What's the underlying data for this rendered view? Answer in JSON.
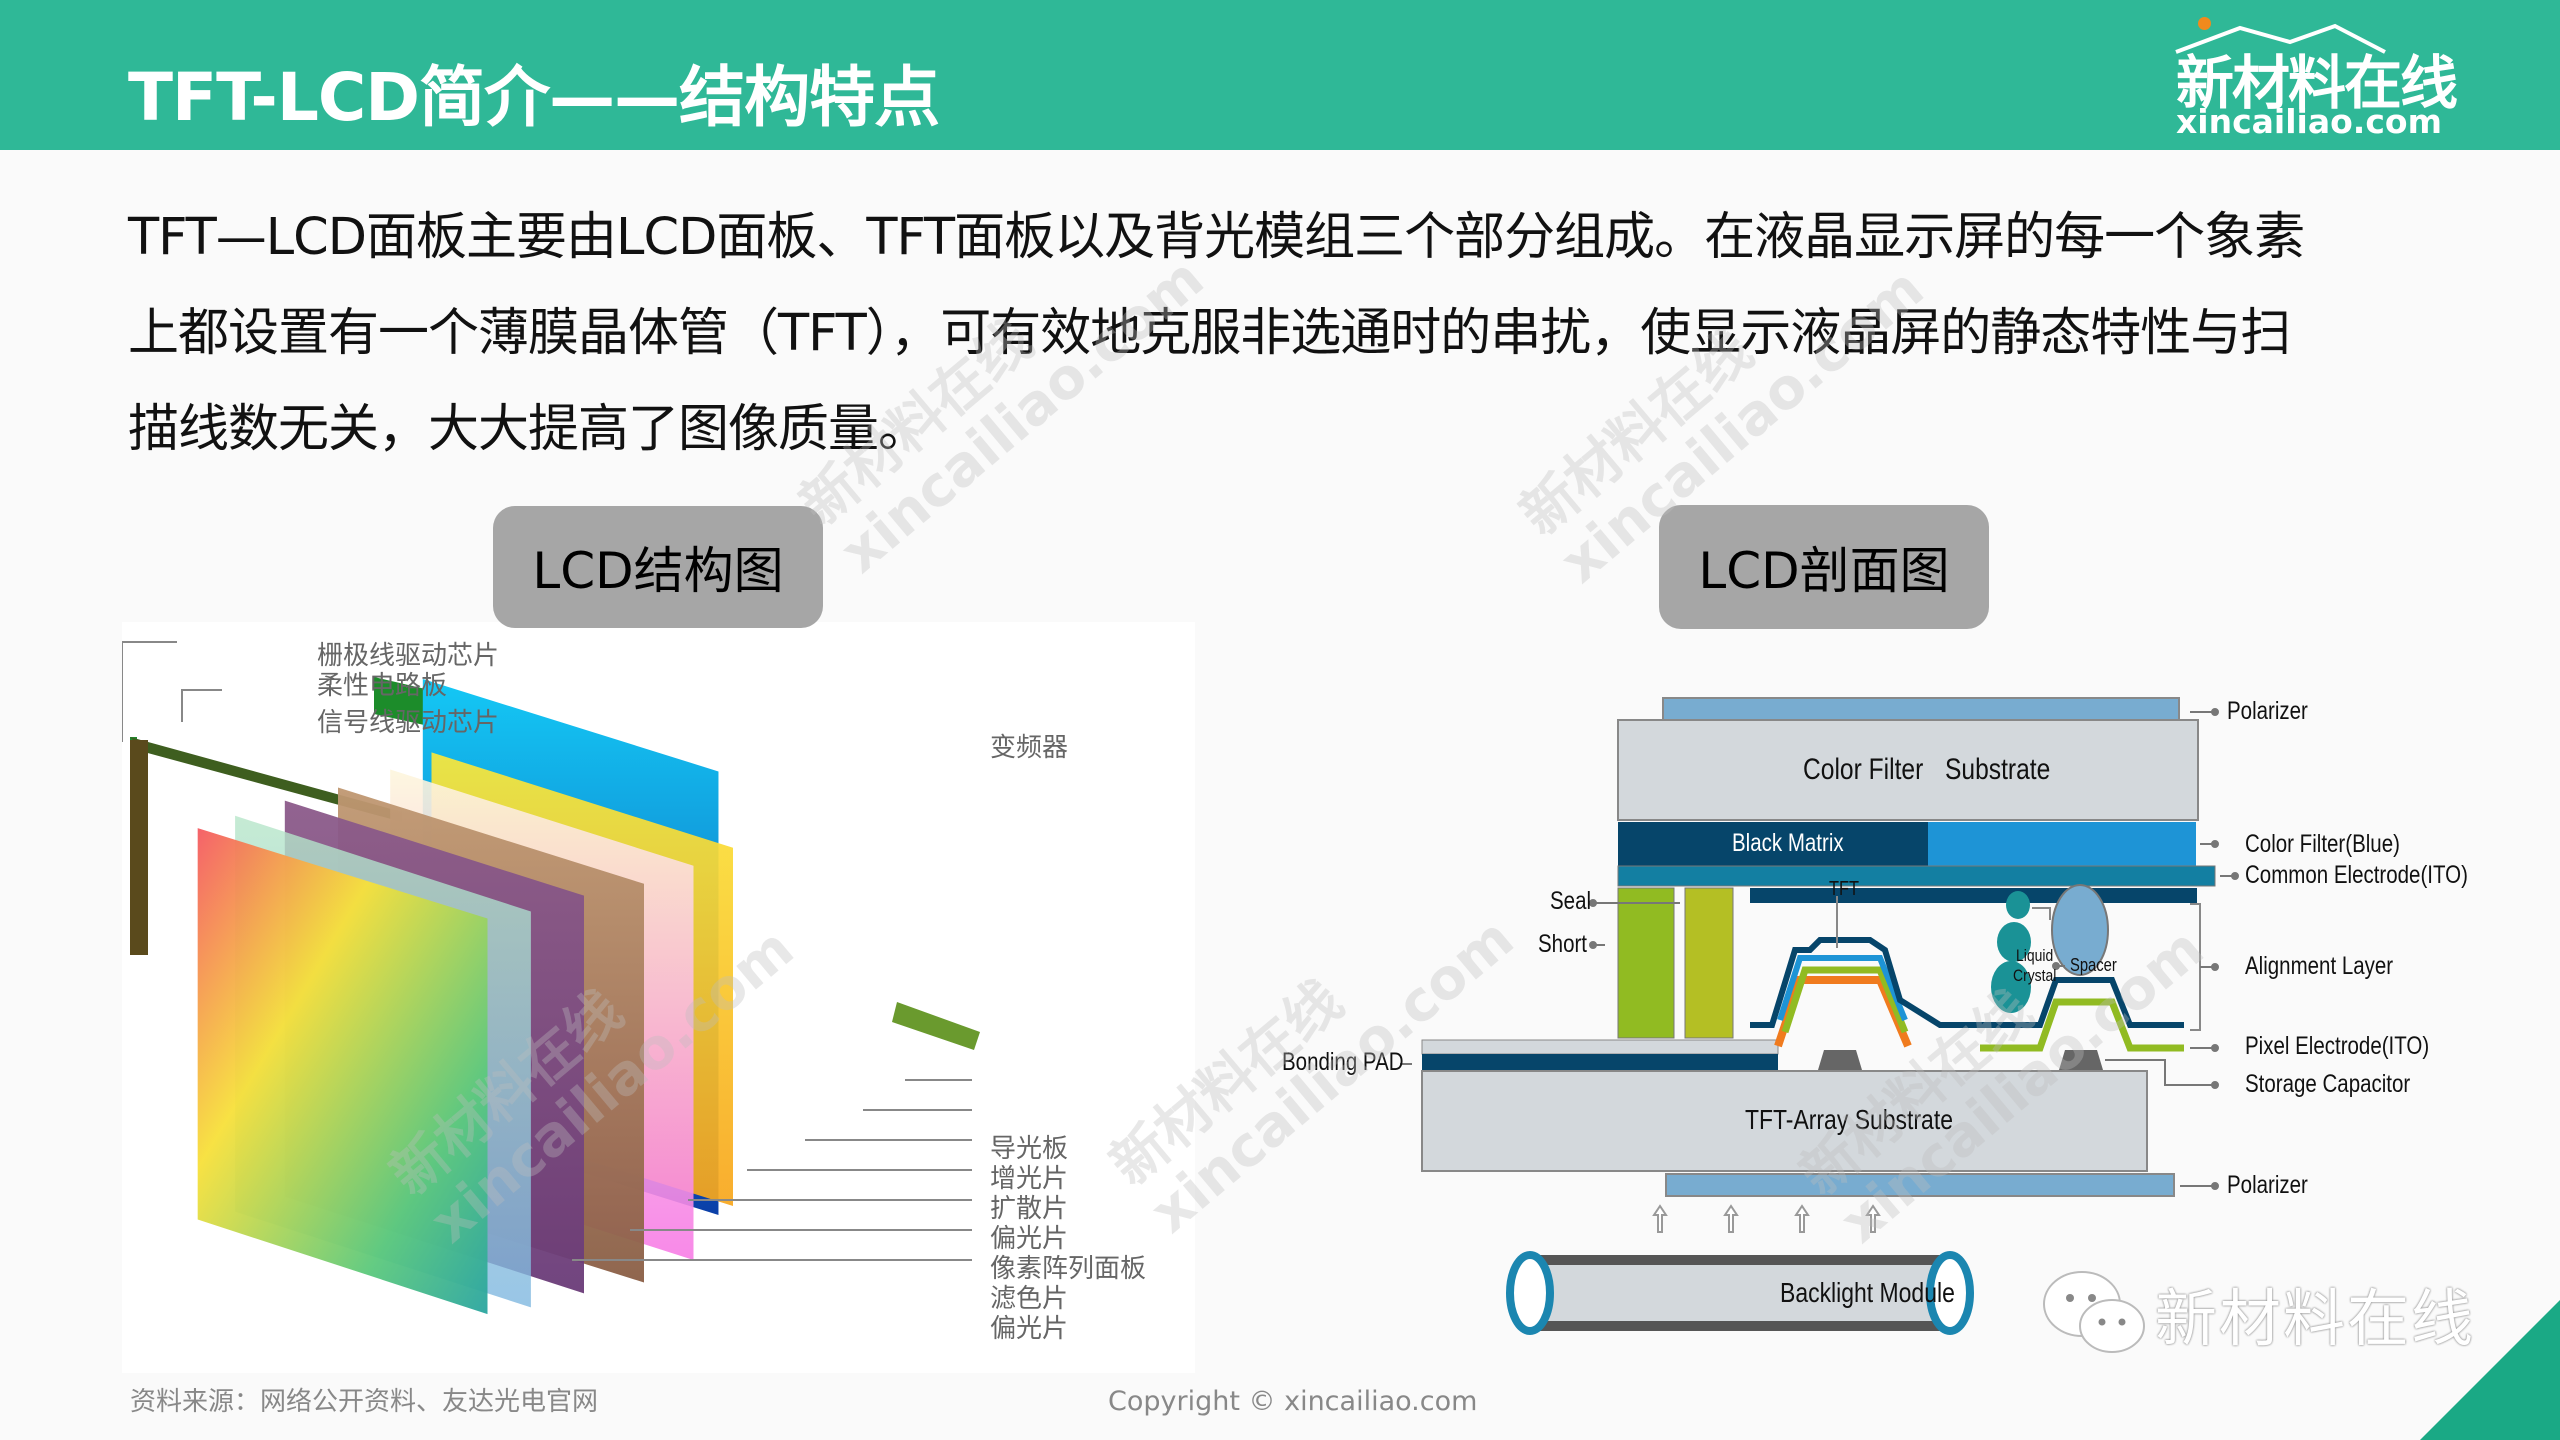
{
  "header": {
    "title": "TFT-LCD简介——结构特点",
    "logo": {
      "cn": "新材料在线",
      "en": "xincailiao.com"
    }
  },
  "body_text": [
    "TFT—LCD面板主要由LCD面板、TFT面板以及背光模组三个部分组成。在液晶显示屏的每一个象素",
    "上都设置有一个薄膜晶体管（TFT），可有效地克服非选通时的串扰，使显示液晶屏的静态特性与扫",
    "描线数无关，大大提高了图像质量。"
  ],
  "sections": {
    "left_label": "LCD结构图",
    "right_label": "LCD剖面图"
  },
  "structure_diagram": {
    "top_labels": [
      "栅极线驱动芯片",
      "柔性电路板",
      "信号线驱动芯片"
    ],
    "inverter_label": "变频器",
    "layer_labels": [
      "导光板",
      "增光片",
      "扩散片",
      "偏光片",
      "像素阵列面板",
      "滤色片",
      "偏光片"
    ]
  },
  "cross_section": {
    "polarizer_top": "Polarizer",
    "color_filter_substrate": [
      "Color Filter",
      "Substrate"
    ],
    "black_matrix": "Black Matrix",
    "color_filter_blue": "Color Filter(Blue)",
    "common_electrode": "Common Electrode(ITO)",
    "seal": "Seal",
    "short": "Short",
    "tft": "TFT",
    "liquid_crystal": [
      "Liquid",
      "Crystal"
    ],
    "spacer": "Spacer",
    "alignment_layer": "Alignment Layer",
    "bonding_pad": "Bonding PAD",
    "pixel_electrode": "Pixel Electrode(ITO)",
    "storage_capacitor": "Storage Capacitor",
    "tft_array_substrate": "TFT-Array Substrate",
    "polarizer_bottom": "Polarizer",
    "backlight_module": "Backlight Module"
  },
  "watermark": {
    "cn": "新材料在线",
    "en": "xincailiao.com"
  },
  "wechat_badge": "新材料在线",
  "footer": {
    "source": "资料来源：网络公开资料、友达光电官网",
    "copyright": "Copyright © xincailiao.com"
  },
  "colors": {
    "header": "#2fb897",
    "label_box": "#a6a6a6",
    "corner_accent": "#1aa985"
  }
}
